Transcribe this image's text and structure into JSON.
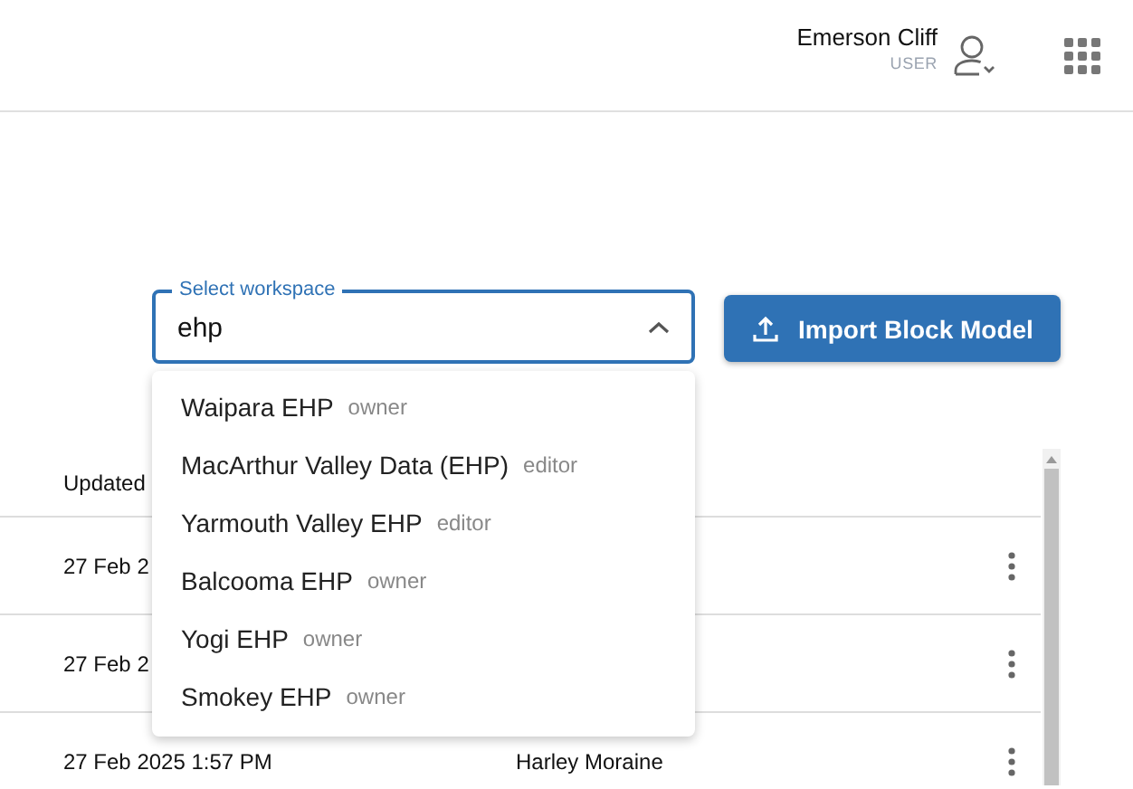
{
  "header": {
    "user_name": "Emerson Cliff",
    "user_role": "USER"
  },
  "workspace_select": {
    "label": "Select workspace",
    "value": "ehp",
    "expanded": true,
    "options": [
      {
        "name": "Waipara EHP",
        "role": "owner"
      },
      {
        "name": "MacArthur Valley Data (EHP)",
        "role": "editor"
      },
      {
        "name": "Yarmouth Valley EHP",
        "role": "editor"
      },
      {
        "name": "Balcooma EHP",
        "role": "owner"
      },
      {
        "name": "Yogi EHP",
        "role": "owner"
      },
      {
        "name": "Smokey EHP",
        "role": "owner"
      }
    ]
  },
  "import_button": {
    "label": "Import Block Model"
  },
  "table": {
    "columns": [
      "Updated"
    ],
    "rows": [
      {
        "updated": "27 Feb 2"
      },
      {
        "updated": "27 Feb 2"
      },
      {
        "updated": "27 Feb 2025 1:57 PM",
        "author": "Harley Moraine"
      }
    ]
  }
}
